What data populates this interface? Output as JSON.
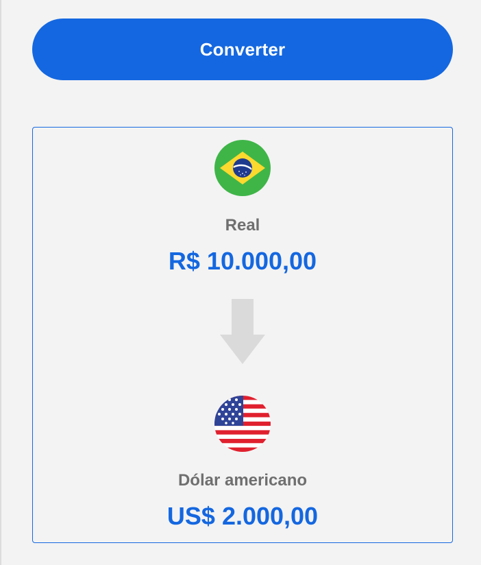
{
  "converter": {
    "button_label": "Converter"
  },
  "result": {
    "from": {
      "flag_icon": "brazil-flag-icon",
      "currency_name": "Real",
      "amount": "R$ 10.000,00"
    },
    "direction_icon": "arrow-down-icon",
    "to": {
      "flag_icon": "usa-flag-icon",
      "currency_name": "Dólar americano",
      "amount": "US$ 2.000,00"
    }
  },
  "colors": {
    "primary": "#1467e0",
    "background": "#f3f3f3",
    "label_gray": "#6f6f6f",
    "arrow_gray": "#dadada"
  }
}
